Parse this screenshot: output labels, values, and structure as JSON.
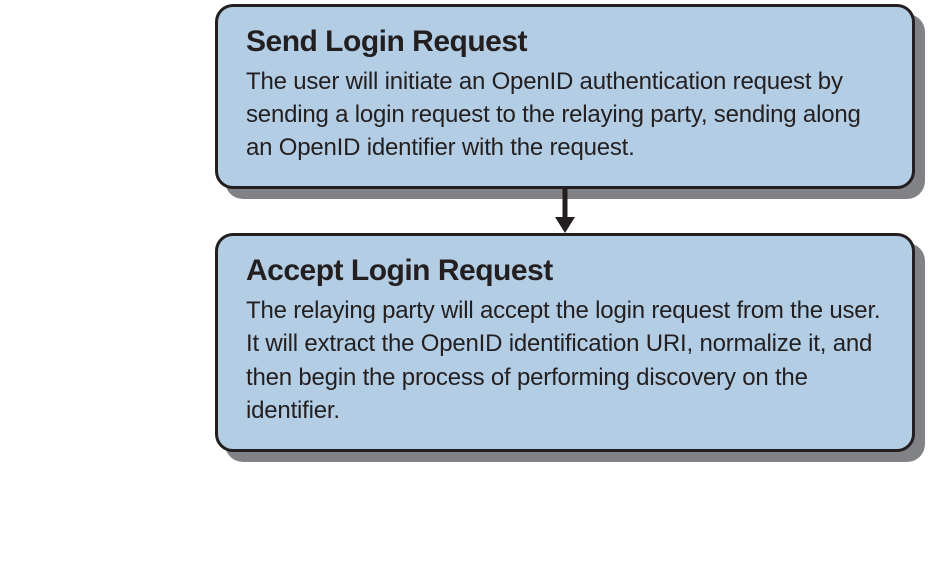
{
  "diagram": {
    "boxes": [
      {
        "title": "Send Login Request",
        "body": "The user will initiate an OpenID authentication request by sending a login request to the relaying party, sending along an OpenID identifier with the request."
      },
      {
        "title": "Accept Login Request",
        "body": "The relaying party will accept the login request from the user. It will extract the OpenID identification URI, normalize it, and then begin the process of performing discovery on the identifier."
      }
    ]
  }
}
